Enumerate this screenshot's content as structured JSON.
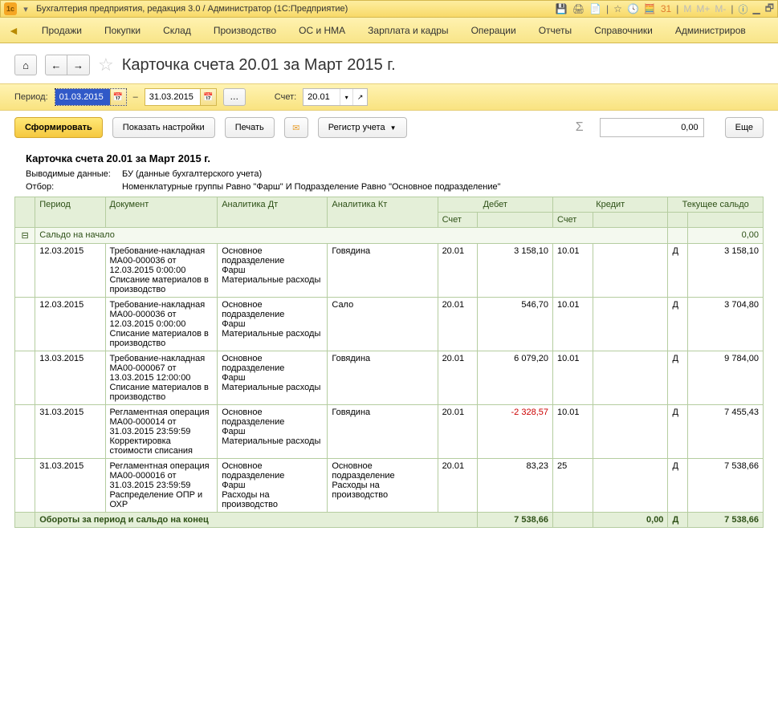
{
  "titlebar": {
    "text": "Бухгалтерия предприятия, редакция 3.0 / Администратор  (1С:Предприятие)"
  },
  "menu": {
    "items": [
      "Продажи",
      "Покупки",
      "Склад",
      "Производство",
      "ОС и НМА",
      "Зарплата и кадры",
      "Операции",
      "Отчеты",
      "Справочники",
      "Администриров"
    ]
  },
  "header": {
    "title": "Карточка счета 20.01 за Март 2015 г."
  },
  "period": {
    "label": "Период:",
    "from": "01.03.2015",
    "dash": "–",
    "to": "31.03.2015",
    "account_label": "Счет:",
    "account": "20.01"
  },
  "actions": {
    "form": "Сформировать",
    "settings": "Показать настройки",
    "print": "Печать",
    "register": "Регистр учета",
    "sum": "0,00",
    "more": "Еще"
  },
  "report": {
    "title": "Карточка счета 20.01 за Март 2015 г.",
    "meta_data_label": "Выводимые данные:",
    "meta_data_value": "БУ (данные бухгалтерского учета)",
    "filter_label": "Отбор:",
    "filter_value": "Номенклатурные группы Равно \"Фарш\" И Подразделение Равно \"Основное подразделение\"",
    "cols": {
      "period": "Период",
      "doc": "Документ",
      "an_dt": "Аналитика Дт",
      "an_kt": "Аналитика Кт",
      "debit": "Дебет",
      "credit": "Кредит",
      "balance": "Текущее сальдо",
      "account": "Счет"
    },
    "opening_label": "Сальдо на начало",
    "opening_value": "0,00",
    "rows": [
      {
        "date": "12.03.2015",
        "doc": "Требование-накладная МА00-000036 от 12.03.2015 0:00:00\nСписание материалов в производство",
        "an_dt": "Основное подразделение\nФарш\nМатериальные расходы",
        "an_kt": "Говядина",
        "dacc": "20.01",
        "damt": "3 158,10",
        "dneg": false,
        "kacc": "10.01",
        "kamt": "",
        "dc": "Д",
        "bal": "3 158,10"
      },
      {
        "date": "12.03.2015",
        "doc": "Требование-накладная МА00-000036 от 12.03.2015 0:00:00\nСписание материалов в производство",
        "an_dt": "Основное подразделение\nФарш\nМатериальные расходы",
        "an_kt": "Сало",
        "dacc": "20.01",
        "damt": "546,70",
        "dneg": false,
        "kacc": "10.01",
        "kamt": "",
        "dc": "Д",
        "bal": "3 704,80"
      },
      {
        "date": "13.03.2015",
        "doc": "Требование-накладная МА00-000067 от 13.03.2015 12:00:00\nСписание материалов в производство",
        "an_dt": "Основное подразделение\nФарш\nМатериальные расходы",
        "an_kt": "Говядина",
        "dacc": "20.01",
        "damt": "6 079,20",
        "dneg": false,
        "kacc": "10.01",
        "kamt": "",
        "dc": "Д",
        "bal": "9 784,00"
      },
      {
        "date": "31.03.2015",
        "doc": "Регламентная операция МА00-000014 от 31.03.2015 23:59:59\nКорректировка стоимости списания",
        "an_dt": "Основное подразделение\nФарш\nМатериальные расходы",
        "an_kt": "Говядина",
        "dacc": "20.01",
        "damt": "-2 328,57",
        "dneg": true,
        "kacc": "10.01",
        "kamt": "",
        "dc": "Д",
        "bal": "7 455,43"
      },
      {
        "date": "31.03.2015",
        "doc": "Регламентная операция МА00-000016 от 31.03.2015 23:59:59\nРаспределение ОПР и ОХР",
        "an_dt": "Основное подразделение\nФарш\nРасходы на производство",
        "an_kt": "Основное подразделение\nРасходы на производство",
        "dacc": "20.01",
        "damt": "83,23",
        "dneg": false,
        "kacc": "25",
        "kamt": "",
        "dc": "Д",
        "bal": "7 538,66"
      }
    ],
    "total_label": "Обороты за период и сальдо на конец",
    "total_debit": "7 538,66",
    "total_credit": "0,00",
    "total_dc": "Д",
    "total_balance": "7 538,66"
  }
}
